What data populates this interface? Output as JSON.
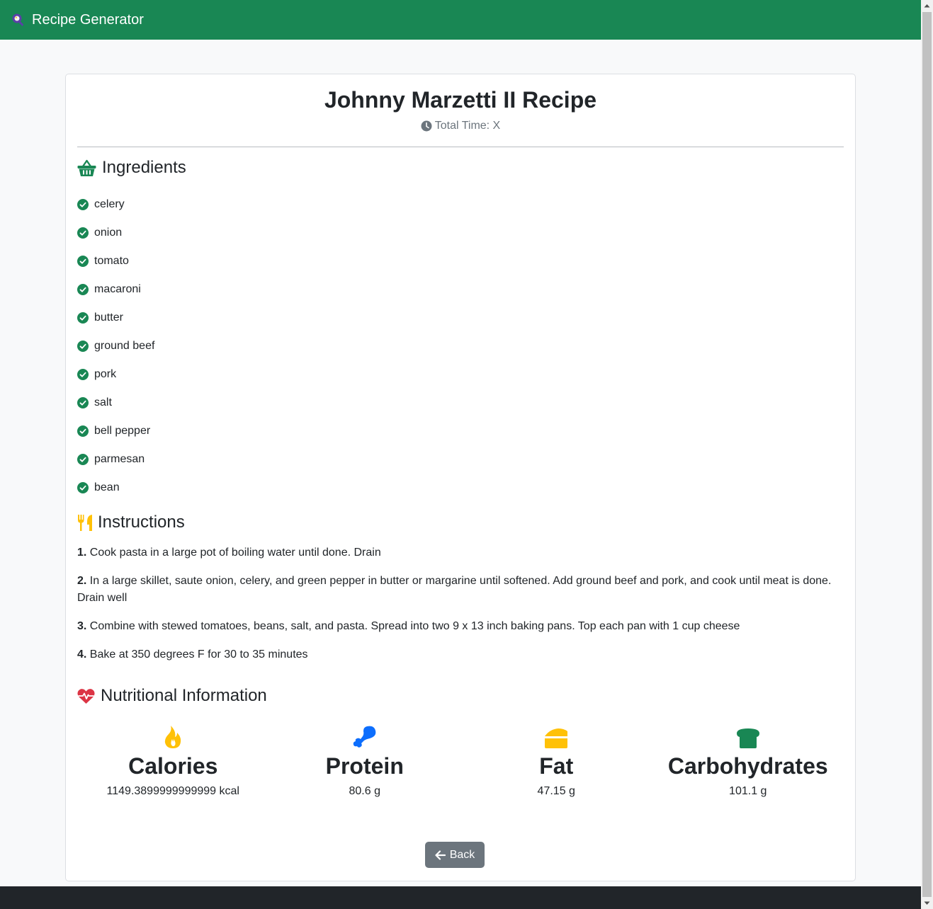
{
  "app": {
    "title": "Recipe Generator"
  },
  "recipe": {
    "title": "Johnny Marzetti II Recipe",
    "total_time": "Total Time: X"
  },
  "ingredients": {
    "heading": "Ingredients",
    "items": [
      "celery",
      "onion",
      "tomato",
      "macaroni",
      "butter",
      "ground beef",
      "pork",
      "salt",
      "bell pepper",
      "parmesan",
      "bean"
    ]
  },
  "instructions": {
    "heading": "Instructions",
    "steps": [
      {
        "num": "1.",
        "text": "Cook pasta in a large pot of boiling water until done. Drain"
      },
      {
        "num": "2.",
        "text": "In a large skillet, saute onion, celery, and green pepper in butter or margarine until softened. Add ground beef and pork, and cook until meat is done. Drain well"
      },
      {
        "num": "3.",
        "text": "Combine with stewed tomatoes, beans, salt, and pasta. Spread into two 9 x 13 inch baking pans. Top each pan with 1 cup cheese"
      },
      {
        "num": "4.",
        "text": "Bake at 350 degrees F for 30 to 35 minutes"
      }
    ]
  },
  "nutrition": {
    "heading": "Nutritional Information",
    "calories": {
      "label": "Calories",
      "value": "1149.3899999999999 kcal",
      "icon": "fire-icon"
    },
    "protein": {
      "label": "Protein",
      "value": "80.6 g",
      "icon": "drumstick-icon"
    },
    "fat": {
      "label": "Fat",
      "value": "47.15 g",
      "icon": "cheese-icon"
    },
    "carbs": {
      "label": "Carbohydrates",
      "value": "101.1 g",
      "icon": "bread-icon"
    }
  },
  "back_label": "Back",
  "colors": {
    "brand": "#198754",
    "secondary": "#6c757d",
    "warning": "#ffc107",
    "primary": "#0d6efd",
    "danger": "#dc3545",
    "footer": "#212529"
  }
}
